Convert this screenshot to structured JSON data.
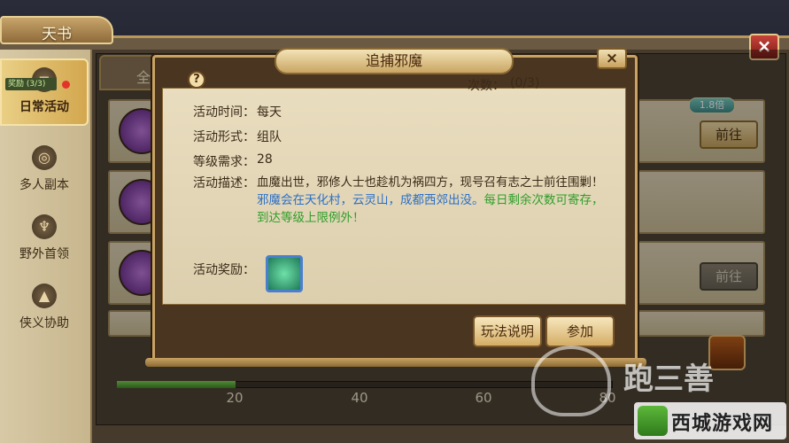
{
  "window": {
    "title": "天书",
    "close": "×"
  },
  "sidebar": {
    "items": [
      {
        "label": "日常活动",
        "icon": "scroll-icon",
        "glyph": "≡"
      },
      {
        "label": "多人副本",
        "icon": "mask-icon",
        "glyph": "◎"
      },
      {
        "label": "野外首领",
        "icon": "demon-icon",
        "glyph": "♆"
      },
      {
        "label": "侠义协助",
        "icon": "hat-icon",
        "glyph": "▲"
      }
    ],
    "badge": "奖励 (3/3)"
  },
  "list": {
    "tab": "全部",
    "multiplier": "1.8倍",
    "go_label": "前往",
    "go_label_2": "前往"
  },
  "progress": {
    "ticks": [
      "20",
      "40",
      "60",
      "80"
    ],
    "fraction": 0.24
  },
  "modal": {
    "title": "追捕邪魔",
    "close": "×",
    "help": "?",
    "count_label": "次数：",
    "count_value": "(0/3)",
    "time_label": "活动时间：",
    "time_value": "每天",
    "form_label": "活动形式：",
    "form_value": "组队",
    "level_label": "等级需求：",
    "level_value": "28",
    "desc_label": "活动描述：",
    "desc_part1": "血魔出世，邪修人士也趁机为祸四方，现号召有志之士前往围剿！",
    "desc_part2": "邪魔会在天化村，云灵山，成都西郊出没。",
    "desc_part3": "每日剩余次数可寄存，到达等级上限例外！",
    "reward_label": "活动奖励：",
    "rule_button": "玩法说明",
    "join_button": "参加"
  },
  "branding": {
    "logo_text": "西城游戏网",
    "watermark": "跑三善"
  },
  "colors": {
    "accent": "#c9a364",
    "highlight_blue": "#2a6fc8",
    "highlight_green": "#2e9e2a",
    "progress_green": "#5fb33c"
  }
}
